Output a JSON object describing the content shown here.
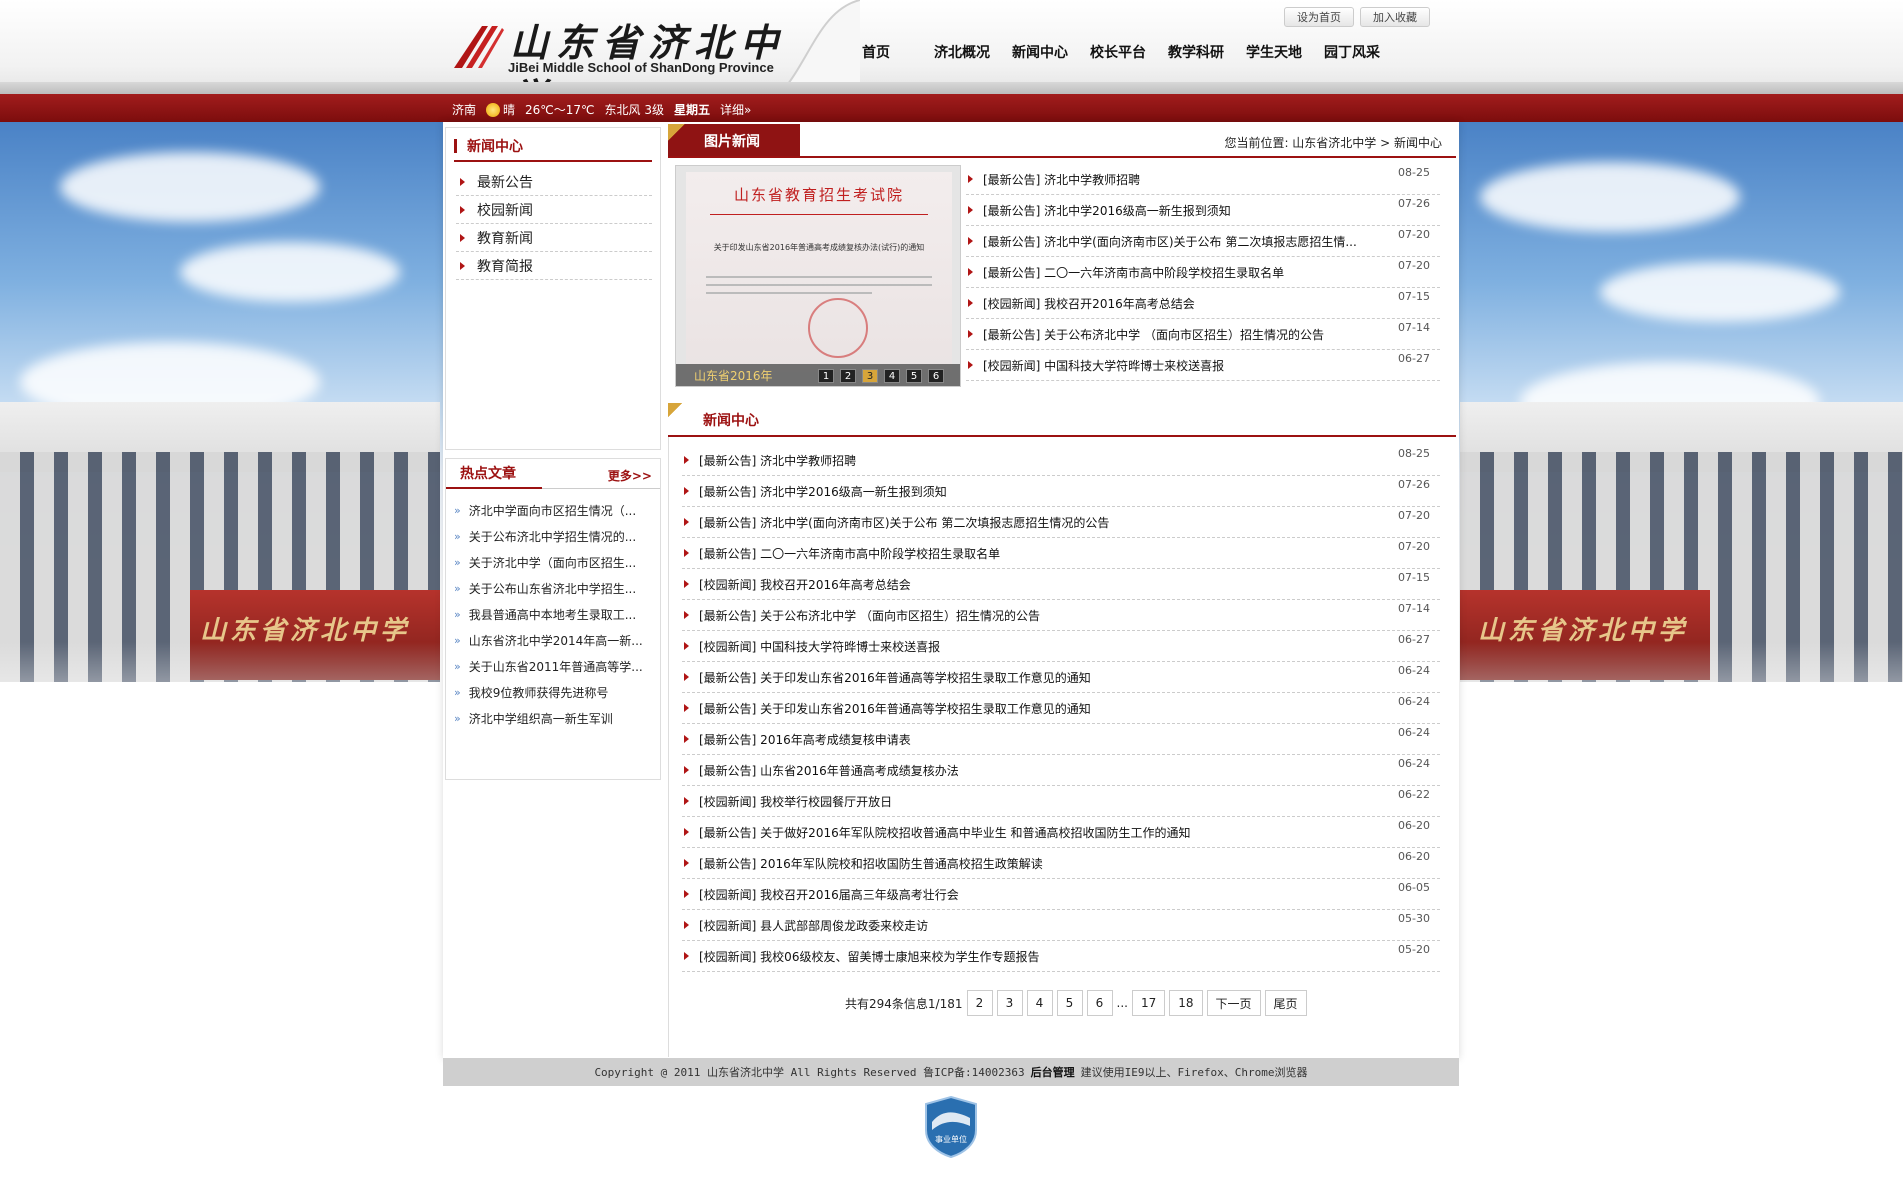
{
  "header": {
    "logo_cn": "山东省济北中学",
    "logo_en": "JiBei Middle School of ShanDong Province",
    "top_links": [
      "设为首页",
      "加入收藏"
    ],
    "nav": [
      "首页",
      "济北概况",
      "新闻中心",
      "校长平台",
      "教学科研",
      "学生天地",
      "园丁风采"
    ]
  },
  "weather": {
    "city": "济南",
    "condition": "晴",
    "temp": "26℃～17℃",
    "wind": "东北风 3级",
    "weekday": "星期五",
    "detail": "详细»"
  },
  "sidebar": {
    "title": "新闻中心",
    "items": [
      "最新公告",
      "校园新闻",
      "教育新闻",
      "教育简报"
    ]
  },
  "hot": {
    "title": "热点文章",
    "more": "更多>>",
    "items": [
      "济北中学面向市区招生情况（...",
      "关于公布济北中学招生情况的...",
      "关于济北中学（面向市区招生...",
      "关于公布山东省济北中学招生...",
      "我县普通高中本地考生录取工...",
      "山东省济北中学2014年高一新...",
      "关于山东省2011年普通高等学...",
      "我校9位教师获得先进称号",
      "济北中学组织高一新生军训"
    ]
  },
  "photo_news": {
    "title": "图片新闻",
    "breadcrumb": "您当前位置: 山东省济北中学 > 新闻中心",
    "photo_doc_title": "山东省教育招生考试院",
    "photo_doc_subtitle": "关于印发山东省2016年普通高考成绩复核办法(试行)的通知",
    "photo_caption": "山东省2016年",
    "pages": [
      "1",
      "2",
      "3",
      "4",
      "5",
      "6"
    ],
    "active_page": "3",
    "items": [
      {
        "text": "[最新公告] 济北中学教师招聘",
        "date": "08-25"
      },
      {
        "text": "[最新公告] 济北中学2016级高一新生报到须知",
        "date": "07-26"
      },
      {
        "text": "[最新公告] 济北中学(面向济南市区)关于公布 第二次填报志愿招生情...",
        "date": "07-20"
      },
      {
        "text": "[最新公告] 二〇一六年济南市高中阶段学校招生录取名单",
        "date": "07-20"
      },
      {
        "text": "[校园新闻] 我校召开2016年高考总结会",
        "date": "07-15"
      },
      {
        "text": "[最新公告] 关于公布济北中学 （面向市区招生）招生情况的公告",
        "date": "07-14"
      },
      {
        "text": "[校园新闻] 中国科技大学符晔博士来校送喜报",
        "date": "06-27"
      }
    ]
  },
  "news_center": {
    "title": "新闻中心",
    "items": [
      {
        "text": "[最新公告] 济北中学教师招聘",
        "date": "08-25"
      },
      {
        "text": "[最新公告] 济北中学2016级高一新生报到须知",
        "date": "07-26"
      },
      {
        "text": "[最新公告] 济北中学(面向济南市区)关于公布 第二次填报志愿招生情况的公告",
        "date": "07-20"
      },
      {
        "text": "[最新公告] 二〇一六年济南市高中阶段学校招生录取名单",
        "date": "07-20"
      },
      {
        "text": "[校园新闻] 我校召开2016年高考总结会",
        "date": "07-15"
      },
      {
        "text": "[最新公告] 关于公布济北中学 （面向市区招生）招生情况的公告",
        "date": "07-14"
      },
      {
        "text": "[校园新闻] 中国科技大学符晔博士来校送喜报",
        "date": "06-27"
      },
      {
        "text": "[最新公告] 关于印发山东省2016年普通高等学校招生录取工作意见的通知",
        "date": "06-24"
      },
      {
        "text": "[最新公告] 关于印发山东省2016年普通高等学校招生录取工作意见的通知",
        "date": "06-24"
      },
      {
        "text": "[最新公告] 2016年高考成绩复核申请表",
        "date": "06-24"
      },
      {
        "text": "[最新公告] 山东省2016年普通高考成绩复核办法",
        "date": "06-24"
      },
      {
        "text": "[校园新闻] 我校举行校园餐厅开放日",
        "date": "06-22"
      },
      {
        "text": "[最新公告] 关于做好2016年军队院校招收普通高中毕业生 和普通高校招收国防生工作的通知",
        "date": "06-20"
      },
      {
        "text": "[最新公告] 2016年军队院校和招收国防生普通高校招生政策解读",
        "date": "06-20"
      },
      {
        "text": "[校园新闻] 我校召开2016届高三年级高考壮行会",
        "date": "06-05"
      },
      {
        "text": "[校园新闻] 县人武部部周俊龙政委来校走访",
        "date": "05-30"
      },
      {
        "text": "[校园新闻] 我校06级校友、留美博士康旭来校为学生作专题报告",
        "date": "05-20"
      }
    ],
    "pagination": {
      "summary": "共有294条信息1/181",
      "pages": [
        "2",
        "3",
        "4",
        "5",
        "6",
        "...",
        "17",
        "18"
      ],
      "next": "下一页",
      "last": "尾页"
    }
  },
  "footer": {
    "copyright": "Copyright @ 2011  山东省济北中学 All Rights Reserved 鲁ICP备:14002363",
    "admin": "后台管理",
    "browser_note": "建议使用IE9以上、Firefox、Chrome浏览器",
    "badge_label": "事业单位"
  },
  "colors": {
    "brand_red": "#9c1111",
    "gold": "#d7a53a"
  }
}
